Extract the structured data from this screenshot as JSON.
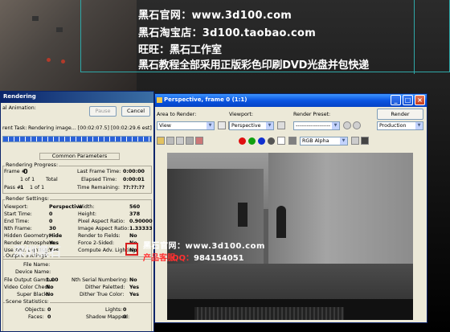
{
  "overlay": {
    "line1": "黑石官网：www.3d100.com",
    "line2": "黑石淘宝店：3d100.taobao.com",
    "line3": "旺旺：黑石工作室",
    "line4": "黑石教程全部采用正版彩色印刷DVD光盘并包快递"
  },
  "rendering": {
    "title": "Rendering",
    "total_animation_label": "al Animation:",
    "pause_label": "Pause",
    "cancel_label": "Cancel",
    "task_label": "rent Task:",
    "task_value": "Rendering image... [00:02:07.5] [00:02:29.6 est]",
    "common_parameters": "Common Parameters",
    "progress": {
      "title": "Rendering Progress:",
      "frame_label": "Frame #",
      "frame_value": "0",
      "of1_label": "1 of 1",
      "total_label": "Total",
      "pass_label": "Pass #",
      "pass_value": "1",
      "pass_of": "1 of 1",
      "last_frame_label": "Last Frame Time:",
      "last_frame_value": "0:00:00",
      "elapsed_label": "Elapsed Time:",
      "elapsed_value": "0:00:01",
      "remaining_label": "Time Remaining:",
      "remaining_value": "??:??:??"
    },
    "settings": {
      "title": "Render Settings:",
      "rows": [
        {
          "label": "Viewport:",
          "value": "Perspective",
          "label2": "Width:",
          "value2": "560"
        },
        {
          "label": "Start Time:",
          "value": "0",
          "label2": "Height:",
          "value2": "378"
        },
        {
          "label": "End Time:",
          "value": "0",
          "label2": "Pixel Aspect Ratio:",
          "value2": "0.90000"
        },
        {
          "label": "Nth Frame:",
          "value": "30",
          "label2": "Image Aspect Ratio:",
          "value2": "1.33333"
        },
        {
          "label": "Hidden Geometry:",
          "value": "Hide",
          "label2": "Render to Fields:",
          "value2": "No"
        },
        {
          "label": "Render Atmosphere:",
          "value": "Yes",
          "label2": "Force 2-Sided:",
          "value2": "No"
        },
        {
          "label": "Use Adv. Lighting:",
          "value": "Yes",
          "label2": "Compute Adv. Lighting:",
          "value2": "No"
        }
      ]
    },
    "output": {
      "title": "Output Settings:",
      "file_name_label": "File Name:",
      "device_name_label": "Device Name:",
      "gamma_label": "File Output Gamma:",
      "gamma_value": "1.00",
      "video_check_label": "Video Color Check:",
      "video_check_value": "No",
      "super_black_label": "Super Black:",
      "super_black_value": "No",
      "nth_serial_label": "Nth Serial Numbering:",
      "nth_serial_value": "No",
      "dither_paletted_label": "Dither Paletted:",
      "dither_paletted_value": "Yes",
      "dither_true_label": "Dither True Color:",
      "dither_true_value": "Yes"
    },
    "scene": {
      "title": "Scene Statistics:",
      "objects_label": "Objects:",
      "objects_value": "0",
      "faces_label": "Faces:",
      "faces_value": "0",
      "lights_label": "Lights:",
      "lights_value": "0",
      "shadow_label": "Shadow Mapped:",
      "shadow_value": "0"
    }
  },
  "perspective": {
    "title": "Perspective, frame 0 (1:1)",
    "area_label": "Area to Render:",
    "area_value": "View",
    "viewport_label": "Viewport:",
    "viewport_value": "Perspective",
    "preset_label": "Render Preset:",
    "preset_value": "-------------------",
    "render_button": "Render",
    "production_value": "Production",
    "channel_value": "RGB Alpha"
  },
  "watermark": {
    "url": "黑石官网：www.3d100.com",
    "qq_label": "QQ：",
    "qq_value": "984154051",
    "studio": "深圳黑石",
    "product": "产品客服"
  },
  "colors": {
    "title_blue": "#0a55e2",
    "dialog_bg": "#ece9d8",
    "accent_cyan": "#2fa8a8"
  }
}
